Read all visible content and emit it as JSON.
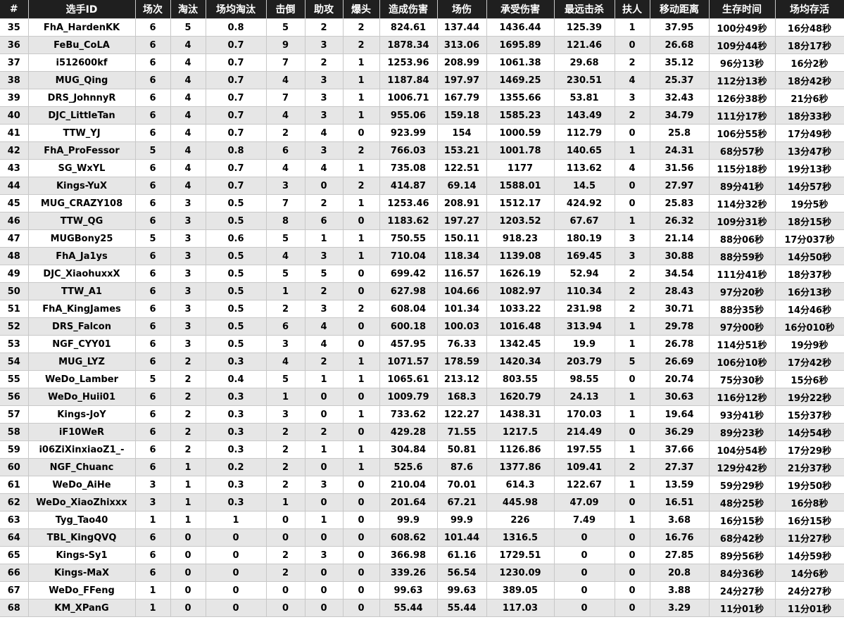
{
  "table": {
    "headers": [
      "#",
      "选手ID",
      "场次",
      "淘汰",
      "场均淘汰",
      "击倒",
      "助攻",
      "爆头",
      "造成伤害",
      "场伤",
      "承受伤害",
      "最远击杀",
      "扶人",
      "移动距离",
      "生存时间",
      "场均存活"
    ],
    "rows": [
      [
        "35",
        "FhA_HardenKK",
        "6",
        "5",
        "0.8",
        "5",
        "2",
        "2",
        "824.61",
        "137.44",
        "1436.44",
        "125.39",
        "1",
        "37.95",
        "100分49秒",
        "16分48秒"
      ],
      [
        "36",
        "FeBu_CoLA",
        "6",
        "4",
        "0.7",
        "9",
        "3",
        "2",
        "1878.34",
        "313.06",
        "1695.89",
        "121.46",
        "0",
        "26.68",
        "109分44秒",
        "18分17秒"
      ],
      [
        "37",
        "i512600kf",
        "6",
        "4",
        "0.7",
        "7",
        "2",
        "1",
        "1253.96",
        "208.99",
        "1061.38",
        "29.68",
        "2",
        "35.12",
        "96分13秒",
        "16分2秒"
      ],
      [
        "38",
        "MUG_Qing",
        "6",
        "4",
        "0.7",
        "4",
        "3",
        "1",
        "1187.84",
        "197.97",
        "1469.25",
        "230.51",
        "4",
        "25.37",
        "112分13秒",
        "18分42秒"
      ],
      [
        "39",
        "DRS_JohnnyR",
        "6",
        "4",
        "0.7",
        "7",
        "3",
        "1",
        "1006.71",
        "167.79",
        "1355.66",
        "53.81",
        "3",
        "32.43",
        "126分38秒",
        "21分6秒"
      ],
      [
        "40",
        "DJC_LittleTan",
        "6",
        "4",
        "0.7",
        "4",
        "3",
        "1",
        "955.06",
        "159.18",
        "1585.23",
        "143.49",
        "2",
        "34.79",
        "111分17秒",
        "18分33秒"
      ],
      [
        "41",
        "TTW_YJ",
        "6",
        "4",
        "0.7",
        "2",
        "4",
        "0",
        "923.99",
        "154",
        "1000.59",
        "112.79",
        "0",
        "25.8",
        "106分55秒",
        "17分49秒"
      ],
      [
        "42",
        "FhA_ProFessor",
        "5",
        "4",
        "0.8",
        "6",
        "3",
        "2",
        "766.03",
        "153.21",
        "1001.78",
        "140.65",
        "1",
        "24.31",
        "68分57秒",
        "13分47秒"
      ],
      [
        "43",
        "SG_WxYL",
        "6",
        "4",
        "0.7",
        "4",
        "4",
        "1",
        "735.08",
        "122.51",
        "1177",
        "113.62",
        "4",
        "31.56",
        "115分18秒",
        "19分13秒"
      ],
      [
        "44",
        "Kings-YuX",
        "6",
        "4",
        "0.7",
        "3",
        "0",
        "2",
        "414.87",
        "69.14",
        "1588.01",
        "14.5",
        "0",
        "27.97",
        "89分41秒",
        "14分57秒"
      ],
      [
        "45",
        "MUG_CRAZY108",
        "6",
        "3",
        "0.5",
        "7",
        "2",
        "1",
        "1253.46",
        "208.91",
        "1512.17",
        "424.92",
        "0",
        "25.83",
        "114分32秒",
        "19分5秒"
      ],
      [
        "46",
        "TTW_QG",
        "6",
        "3",
        "0.5",
        "8",
        "6",
        "0",
        "1183.62",
        "197.27",
        "1203.52",
        "67.67",
        "1",
        "26.32",
        "109分31秒",
        "18分15秒"
      ],
      [
        "47",
        "MUGBony25",
        "5",
        "3",
        "0.6",
        "5",
        "1",
        "1",
        "750.55",
        "150.11",
        "918.23",
        "180.19",
        "3",
        "21.14",
        "88分06秒",
        "17分037秒"
      ],
      [
        "48",
        "FhA_Ja1ys",
        "6",
        "3",
        "0.5",
        "4",
        "3",
        "1",
        "710.04",
        "118.34",
        "1139.08",
        "169.45",
        "3",
        "30.88",
        "88分59秒",
        "14分50秒"
      ],
      [
        "49",
        "DJC_XiaohuxxX",
        "6",
        "3",
        "0.5",
        "5",
        "5",
        "0",
        "699.42",
        "116.57",
        "1626.19",
        "52.94",
        "2",
        "34.54",
        "111分41秒",
        "18分37秒"
      ],
      [
        "50",
        "TTW_A1",
        "6",
        "3",
        "0.5",
        "1",
        "2",
        "0",
        "627.98",
        "104.66",
        "1082.97",
        "110.34",
        "2",
        "28.43",
        "97分20秒",
        "16分13秒"
      ],
      [
        "51",
        "FhA_KingJames",
        "6",
        "3",
        "0.5",
        "2",
        "3",
        "2",
        "608.04",
        "101.34",
        "1033.22",
        "231.98",
        "2",
        "30.71",
        "88分35秒",
        "14分46秒"
      ],
      [
        "52",
        "DRS_Falcon",
        "6",
        "3",
        "0.5",
        "6",
        "4",
        "0",
        "600.18",
        "100.03",
        "1016.48",
        "313.94",
        "1",
        "29.78",
        "97分00秒",
        "16分010秒"
      ],
      [
        "53",
        "NGF_CYY01",
        "6",
        "3",
        "0.5",
        "3",
        "4",
        "0",
        "457.95",
        "76.33",
        "1342.45",
        "19.9",
        "1",
        "26.78",
        "114分51秒",
        "19分9秒"
      ],
      [
        "54",
        "MUG_LYZ",
        "6",
        "2",
        "0.3",
        "4",
        "2",
        "1",
        "1071.57",
        "178.59",
        "1420.34",
        "203.79",
        "5",
        "26.69",
        "106分10秒",
        "17分42秒"
      ],
      [
        "55",
        "WeDo_Lamber",
        "5",
        "2",
        "0.4",
        "5",
        "1",
        "1",
        "1065.61",
        "213.12",
        "803.55",
        "98.55",
        "0",
        "20.74",
        "75分30秒",
        "15分6秒"
      ],
      [
        "56",
        "WeDo_Huii01",
        "6",
        "2",
        "0.3",
        "1",
        "0",
        "0",
        "1009.79",
        "168.3",
        "1620.79",
        "24.13",
        "1",
        "30.63",
        "116分12秒",
        "19分22秒"
      ],
      [
        "57",
        "Kings-JoY",
        "6",
        "2",
        "0.3",
        "3",
        "0",
        "1",
        "733.62",
        "122.27",
        "1438.31",
        "170.03",
        "1",
        "19.64",
        "93分41秒",
        "15分37秒"
      ],
      [
        "58",
        "iF10WeR",
        "6",
        "2",
        "0.3",
        "2",
        "2",
        "0",
        "429.28",
        "71.55",
        "1217.5",
        "214.49",
        "0",
        "36.29",
        "89分23秒",
        "14分54秒"
      ],
      [
        "59",
        "i06ZiXinxiaoZ1_-",
        "6",
        "2",
        "0.3",
        "2",
        "1",
        "1",
        "304.84",
        "50.81",
        "1126.86",
        "197.55",
        "1",
        "37.66",
        "104分54秒",
        "17分29秒"
      ],
      [
        "60",
        "NGF_Chuanc",
        "6",
        "1",
        "0.2",
        "2",
        "0",
        "1",
        "525.6",
        "87.6",
        "1377.86",
        "109.41",
        "2",
        "27.37",
        "129分42秒",
        "21分37秒"
      ],
      [
        "61",
        "WeDo_AiHe",
        "3",
        "1",
        "0.3",
        "2",
        "3",
        "0",
        "210.04",
        "70.01",
        "614.3",
        "122.67",
        "1",
        "13.59",
        "59分29秒",
        "19分50秒"
      ],
      [
        "62",
        "WeDo_XiaoZhixxx",
        "3",
        "1",
        "0.3",
        "1",
        "0",
        "0",
        "201.64",
        "67.21",
        "445.98",
        "47.09",
        "0",
        "16.51",
        "48分25秒",
        "16分8秒"
      ],
      [
        "63",
        "Tyg_Tao40",
        "1",
        "1",
        "1",
        "0",
        "1",
        "0",
        "99.9",
        "99.9",
        "226",
        "7.49",
        "1",
        "3.68",
        "16分15秒",
        "16分15秒"
      ],
      [
        "64",
        "TBL_KingQVQ",
        "6",
        "0",
        "0",
        "0",
        "0",
        "0",
        "608.62",
        "101.44",
        "1316.5",
        "0",
        "0",
        "16.76",
        "68分42秒",
        "11分27秒"
      ],
      [
        "65",
        "Kings-Sy1",
        "6",
        "0",
        "0",
        "2",
        "3",
        "0",
        "366.98",
        "61.16",
        "1729.51",
        "0",
        "0",
        "27.85",
        "89分56秒",
        "14分59秒"
      ],
      [
        "66",
        "Kings-MaX",
        "6",
        "0",
        "0",
        "2",
        "0",
        "0",
        "339.26",
        "56.54",
        "1230.09",
        "0",
        "0",
        "20.8",
        "84分36秒",
        "14分6秒"
      ],
      [
        "67",
        "WeDo_FFeng",
        "1",
        "0",
        "0",
        "0",
        "0",
        "0",
        "99.63",
        "99.63",
        "389.05",
        "0",
        "0",
        "3.88",
        "24分27秒",
        "24分27秒"
      ],
      [
        "68",
        "KM_XPanG",
        "1",
        "0",
        "0",
        "0",
        "0",
        "0",
        "55.44",
        "55.44",
        "117.03",
        "0",
        "0",
        "3.29",
        "11分01秒",
        "11分01秒"
      ]
    ]
  }
}
